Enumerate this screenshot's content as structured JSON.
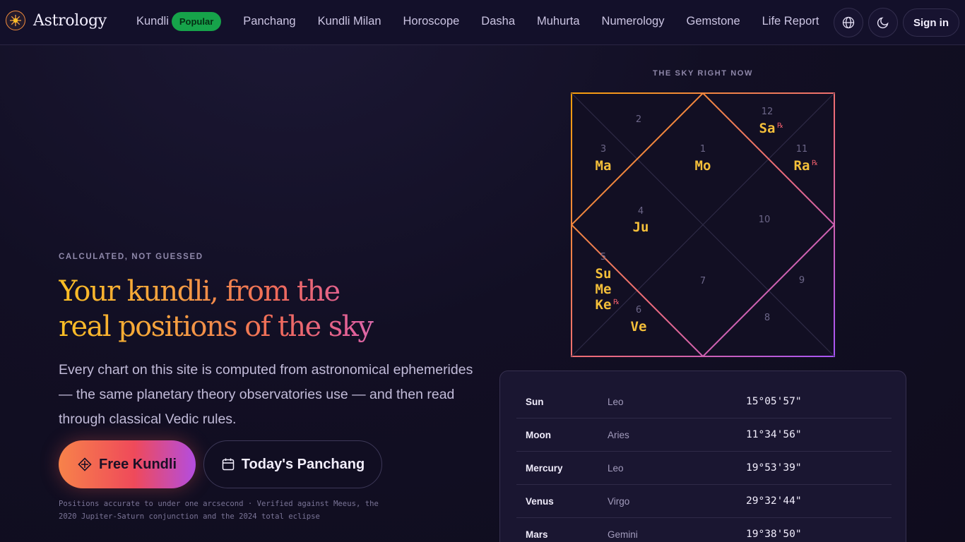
{
  "brand": {
    "name": "Astrology"
  },
  "nav": {
    "links": [
      "Kundli",
      "Panchang",
      "Kundli Milan",
      "Horoscope",
      "Dasha",
      "Muhurta",
      "Numerology",
      "Gemstone",
      "Life Report"
    ],
    "badge": "Popular",
    "signin": "Sign in"
  },
  "hero": {
    "eyebrow": "CALCULATED, NOT GUESSED",
    "headline_line1": "Your kundli, from the",
    "headline_line2": "real positions of the sky",
    "lead": "Every chart on this site is computed from astronomical ephemerides — the same planetary theory observatories use — and then read through classical Vedic rules.",
    "primary_cta": "Free Kundli",
    "secondary_cta": "Today's Panchang",
    "note": "Positions accurate to under one arcsecond · Verified against Meeus, the 2020 Jupiter-Saturn conjunction and the 2024 total eclipse"
  },
  "sky": {
    "label": "THE SKY RIGHT NOW",
    "houses": [
      {
        "num": "1",
        "planets": [
          "Mo"
        ],
        "retro": [
          false
        ]
      },
      {
        "num": "2",
        "planets": [],
        "retro": []
      },
      {
        "num": "3",
        "planets": [
          "Ma"
        ],
        "retro": [
          false
        ]
      },
      {
        "num": "4",
        "planets": [
          "Ju"
        ],
        "retro": [
          false
        ]
      },
      {
        "num": "5",
        "planets": [
          "Su",
          "Me",
          "Ke"
        ],
        "retro": [
          false,
          false,
          true
        ]
      },
      {
        "num": "6",
        "planets": [
          "Ve"
        ],
        "retro": [
          false
        ]
      },
      {
        "num": "7",
        "planets": [],
        "retro": []
      },
      {
        "num": "8",
        "planets": [],
        "retro": []
      },
      {
        "num": "9",
        "planets": [],
        "retro": []
      },
      {
        "num": "10",
        "planets": [],
        "retro": []
      },
      {
        "num": "11",
        "planets": [
          "Ra"
        ],
        "retro": [
          true
        ]
      },
      {
        "num": "12",
        "planets": [
          "Sa"
        ],
        "retro": [
          true
        ]
      }
    ],
    "retro_symbol": "℞",
    "colors": {
      "planet": "#f4bf3a",
      "retro": "#ef5f6c",
      "border_start": "#f59e0b",
      "border_end": "#a855f7"
    }
  },
  "positions": [
    {
      "planet": "Sun",
      "sign": "Leo",
      "degree": "15°05'57\""
    },
    {
      "planet": "Moon",
      "sign": "Aries",
      "degree": "11°34'56\""
    },
    {
      "planet": "Mercury",
      "sign": "Leo",
      "degree": "19°53'39\""
    },
    {
      "planet": "Venus",
      "sign": "Virgo",
      "degree": "29°32'44\""
    },
    {
      "planet": "Mars",
      "sign": "Gemini",
      "degree": "19°38'50\""
    }
  ]
}
